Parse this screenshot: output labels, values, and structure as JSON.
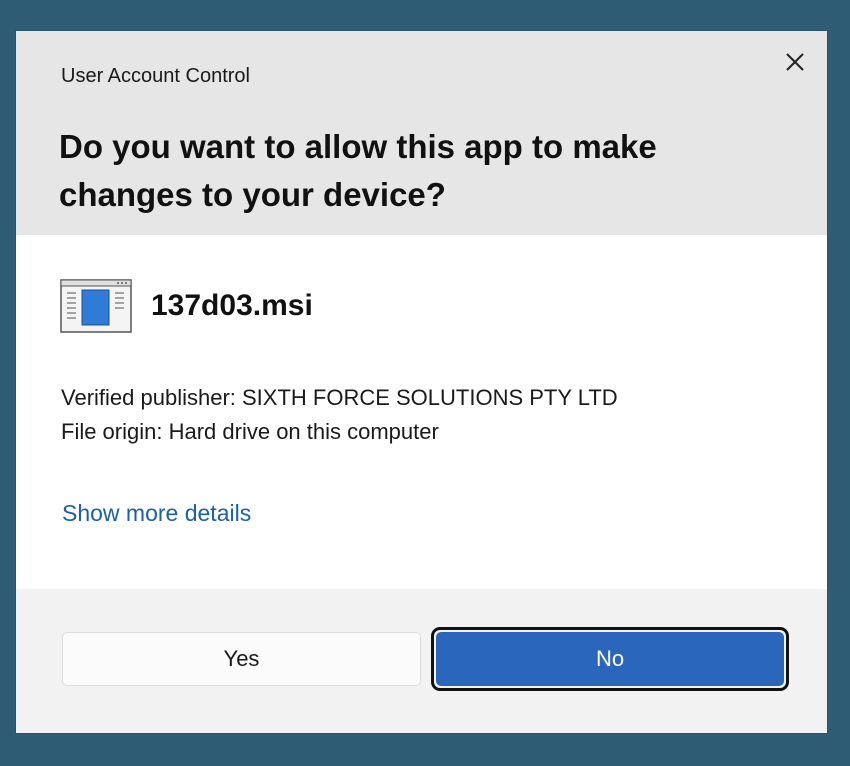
{
  "dialog": {
    "app_title": "User Account Control",
    "question_line1": "Do you want to allow this app to make",
    "question_line2": "changes to your device?",
    "close_icon": "close-icon"
  },
  "app": {
    "icon": "installer-window-icon",
    "name": "137d03.msi"
  },
  "details": {
    "publisher": "Verified publisher: SIXTH FORCE SOLUTIONS PTY LTD",
    "origin": "File origin: Hard drive on this computer",
    "more_link": "Show more details"
  },
  "buttons": {
    "yes_label": "Yes",
    "no_label": "No"
  },
  "colors": {
    "background": "#2e5c75",
    "header": "#e6e6e6",
    "link": "#1d5fa8",
    "primary": "#2b66bd"
  }
}
